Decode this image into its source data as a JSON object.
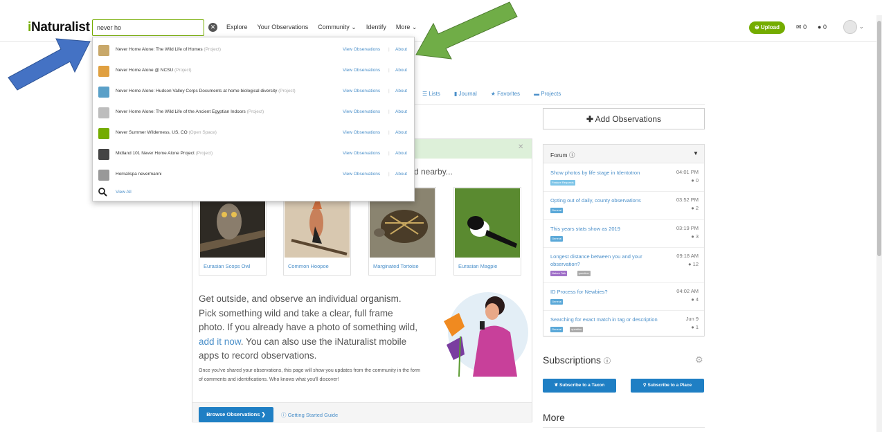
{
  "header": {
    "logo": "iNaturalist",
    "search_value": "never ho",
    "nav": [
      "Explore",
      "Your Observations",
      "Community",
      "Identify",
      "More"
    ],
    "upload_label": "Upload",
    "messages_count": "0",
    "notifications_count": "0"
  },
  "search_results": [
    {
      "name": "Never Home Alone: The Wild Life of Homes",
      "type": "(Project)",
      "has_view": true,
      "thumb_color": "#c8a86a"
    },
    {
      "name": "Never Home Alone @ NCSU",
      "type": "(Project)",
      "has_view": true,
      "thumb_color": "#e0a040"
    },
    {
      "name": "Never Home Alone: Hudson Valley Corps Documents at home biological diversity",
      "type": "(Project)",
      "has_view": true,
      "thumb_color": "#5aa0c8"
    },
    {
      "name": "Never Home Alone: The Wild Life of the Ancient Egyptian Indoors",
      "type": "(Project)",
      "has_view": true,
      "thumb_color": "#bdbdbd"
    },
    {
      "name": "Never Summer Wilderness, US, CO",
      "type": "(Open Space)",
      "has_view": true,
      "thumb_color": "#74ac00"
    },
    {
      "name": "Midland 101 Never Home Alone Project",
      "type": "(Project)",
      "has_view": true,
      "thumb_color": "#444444"
    },
    {
      "name": "Homalispa nevermanni",
      "type": "",
      "has_view": true,
      "thumb_color": "#999999"
    }
  ],
  "search_labels": {
    "view_observations": "View Observations",
    "about": "About",
    "view_all": "View All"
  },
  "tabs": [
    "Lists",
    "Journal",
    "Favorites",
    "Projects"
  ],
  "add_observations": "Add Observations",
  "main": {
    "nearby_text": "d nearby...",
    "species": [
      "Eurasian Scops Owl",
      "Common Hoopoe",
      "Marginated Tortoise",
      "Eurasian Magpie"
    ],
    "intro_before": "Get outside, and observe an individual organism. Pick something wild and take a clear, full frame photo. If you already have a photo of something wild, ",
    "intro_link": "add it now",
    "intro_after": ". You can also use the iNaturalist mobile apps to record observations.",
    "after_text": "Once you've shared your observations, this page will show you updates from the community in the form of comments and identifications. Who knows what you'll discover!",
    "browse_button": "Browse Observations",
    "guide_link": "Getting Started Guide"
  },
  "forum": {
    "title": "Forum",
    "topics": [
      {
        "title": "Show photos by life stage in Identotron",
        "time": "04:01 PM",
        "count": "0",
        "tags": [
          "Feature Requests"
        ]
      },
      {
        "title": "Opting out of daily, county observations",
        "time": "03:52 PM",
        "count": "2",
        "tags": [
          "General"
        ]
      },
      {
        "title": "This years stats show as 2019",
        "time": "03:19 PM",
        "count": "3",
        "tags": [
          "General"
        ]
      },
      {
        "title": "Longest distance between you and your observation?",
        "time": "09:18 AM",
        "count": "12",
        "tags": [
          "Nature Talk",
          "question"
        ]
      },
      {
        "title": "ID Process for Newbies?",
        "time": "04:02 AM",
        "count": "4",
        "tags": [
          "General"
        ]
      },
      {
        "title": "Searching for exact match in tag or description",
        "time": "Jun 9",
        "count": "1",
        "tags": [
          "General",
          "question"
        ]
      }
    ]
  },
  "subscriptions": {
    "title": "Subscriptions",
    "taxon_button": "Subscribe to a Taxon",
    "place_button": "Subscribe to a Place"
  },
  "more_title": "More",
  "colors": {
    "brand_green": "#74ac00",
    "link_blue": "#4a8fc9",
    "button_blue": "#1f7fc4",
    "arrow_blue": "#4472c4",
    "arrow_green": "#70ad47"
  }
}
